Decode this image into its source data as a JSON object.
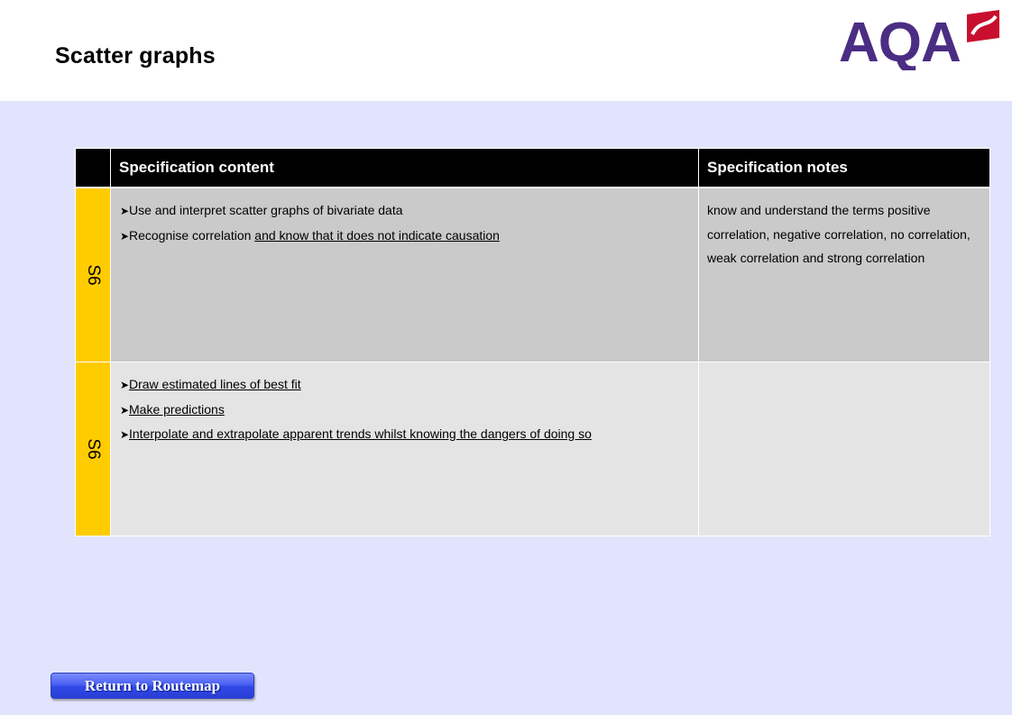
{
  "page": {
    "title": "Scatter graphs"
  },
  "logo": {
    "text": "AQA",
    "icon": "aqa-logo-icon",
    "colors": {
      "text": "#4b2d83",
      "mark": "#c8102e"
    }
  },
  "table": {
    "headers": {
      "code": "",
      "content": "Specification content",
      "notes": "Specification notes"
    },
    "rows": [
      {
        "code": "S6",
        "content": [
          {
            "prefix": "Use and interpret scatter graphs of bivariate data",
            "underlined": ""
          },
          {
            "prefix": "Recognise correlation ",
            "underlined": "and know that it does not indicate causation"
          }
        ],
        "notes": "know and understand the terms positive correlation, negative correlation, no correlation, weak correlation and strong correlation"
      },
      {
        "code": "S6",
        "content": [
          {
            "prefix": "",
            "underlined": "Draw estimated lines of best fit"
          },
          {
            "prefix": "",
            "underlined": "Make predictions"
          },
          {
            "prefix": "",
            "underlined": "Interpolate and extrapolate apparent trends whilst knowing the dangers of doing so"
          }
        ],
        "notes": ""
      }
    ]
  },
  "footer": {
    "return_label": "Return to Routemap"
  },
  "colors": {
    "background": "#e2e4fd",
    "header_bg": "#000000",
    "code_bg": "#ffcc00",
    "row_a_bg": "#cacaca",
    "row_b_bg": "#e4e4e4",
    "button": "#3f57ee"
  }
}
